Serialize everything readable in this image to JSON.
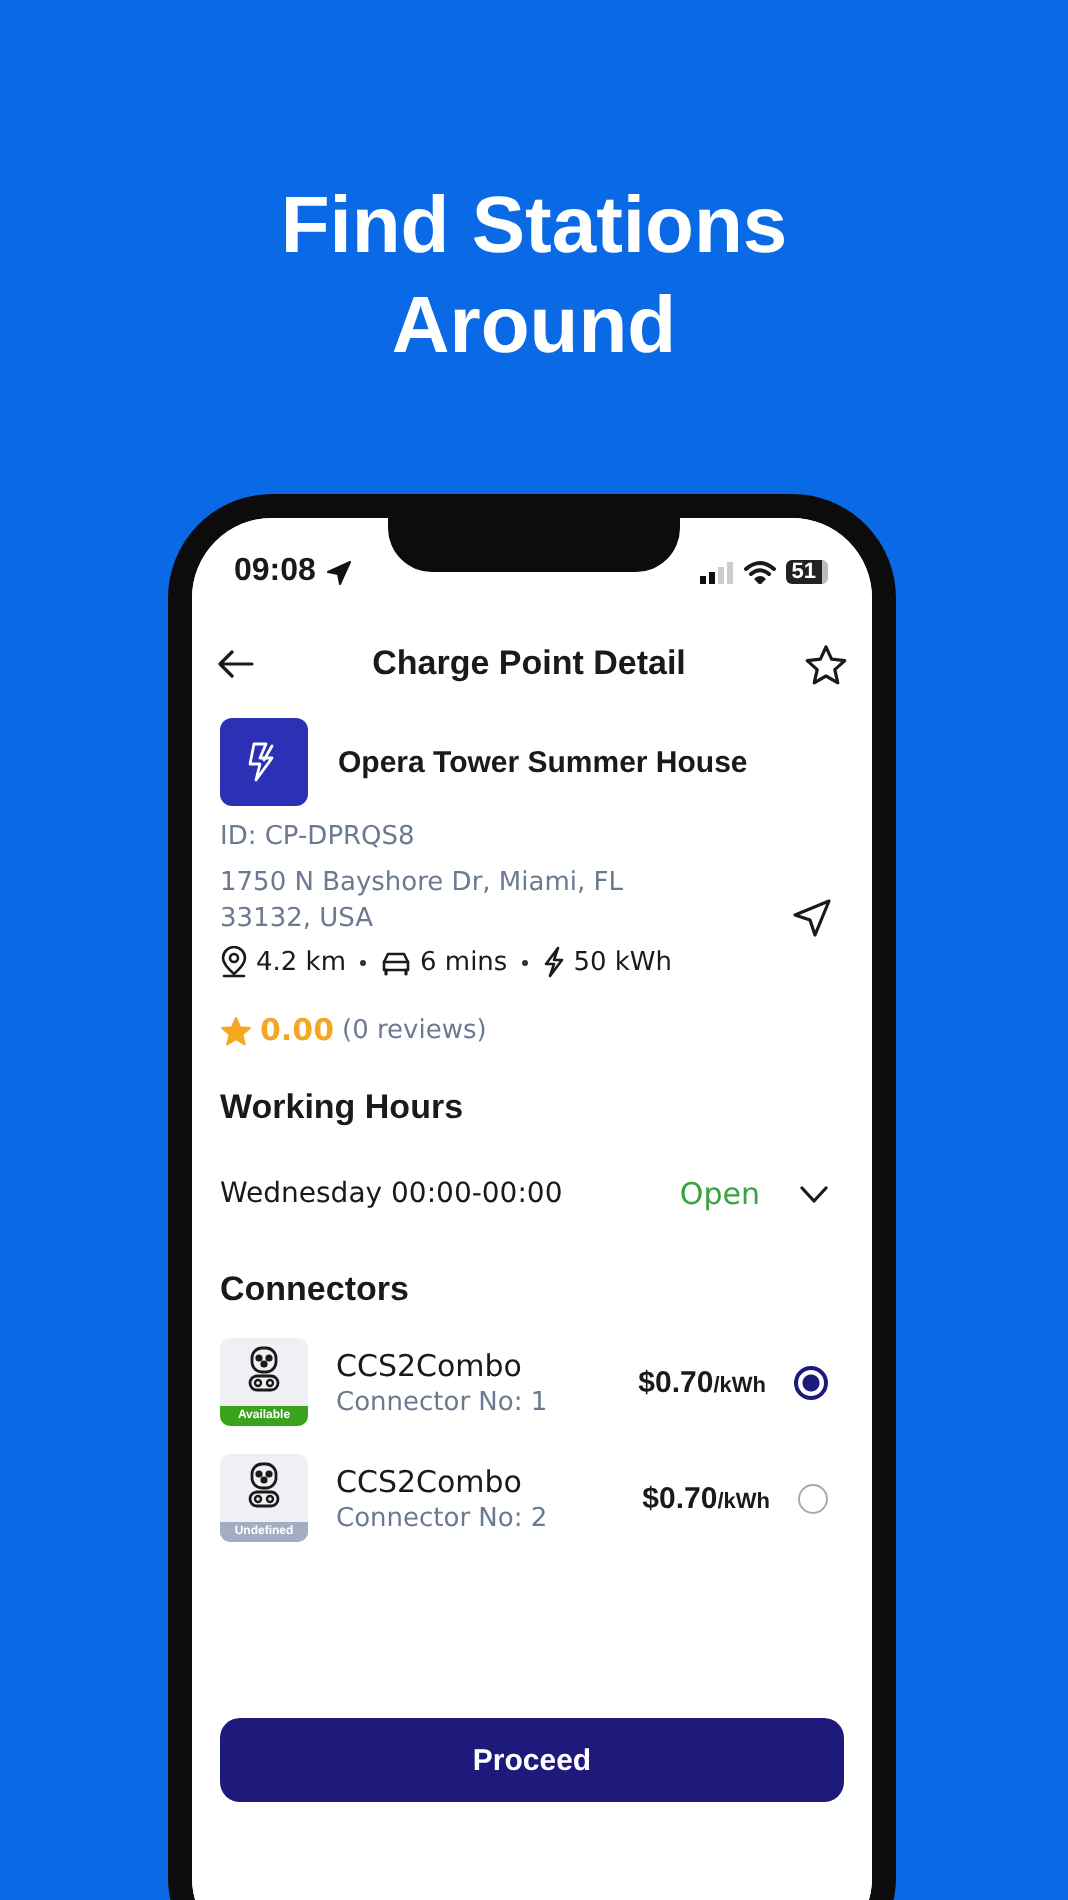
{
  "headline": "Find Stations Around",
  "status_bar": {
    "time": "09:08",
    "battery": "51"
  },
  "header": {
    "title": "Charge Point Detail"
  },
  "station": {
    "name": "Opera Tower Summer House",
    "id": "ID: CP-DPRQS8",
    "address": "1750 N Bayshore Dr, Miami, FL 33132, USA",
    "distance": "4.2 km",
    "duration": "6 mins",
    "power": "50 kWh",
    "rating": "0.00",
    "reviews": "(0 reviews)"
  },
  "working_hours": {
    "title": "Working Hours",
    "day": "Wednesday 00:00-00:00",
    "status": "Open",
    "expanded": false
  },
  "connectors_title": "Connectors",
  "connectors": [
    {
      "name": "CCS2Combo",
      "number": "Connector No: 1",
      "badge": "Available",
      "color": "#3aa31c",
      "price": "$0.70",
      "unit": "/kWh",
      "selected": true
    },
    {
      "name": "CCS2Combo",
      "number": "Connector No: 2",
      "badge": "Undefined",
      "color": "#a3adc2",
      "price": "$0.70",
      "unit": "/kWh",
      "selected": false
    }
  ],
  "button": "Proceed"
}
